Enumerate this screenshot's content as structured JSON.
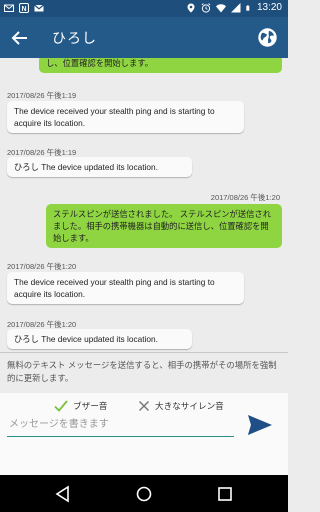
{
  "status_bar": {
    "left_icons": [
      "mail-icon",
      "notification-n-icon",
      "gmail-icon"
    ],
    "right_icons": [
      "location-icon",
      "alarm-icon",
      "wifi-icon",
      "signal-icon",
      "battery-icon"
    ],
    "time": "13:20"
  },
  "app_bar": {
    "title": "ひろし",
    "back_icon": "back-arrow-icon",
    "action_icon": "globe-icon",
    "color": "#245a89"
  },
  "messages": [
    {
      "direction": "out",
      "text": "し、位置確認を開始します。"
    },
    {
      "direction": "in",
      "timestamp": "2017/08/26 午後1:19",
      "text": "The device received your stealth ping and is starting to acquire its location."
    },
    {
      "direction": "in",
      "timestamp": "2017/08/26 午後1:19",
      "text": "ひろし The device updated its location."
    },
    {
      "direction": "out",
      "timestamp": "2017/08/26 午後1:20",
      "text": "ステルスピンが送信されました。 ステルスピンが送信されました。相手の携帯機器は自動的に送信し、位置確認を開始します。"
    },
    {
      "direction": "in",
      "timestamp": "2017/08/26 午後1:20",
      "text": "The device received your stealth ping and is starting to acquire its location."
    },
    {
      "direction": "in",
      "timestamp": "2017/08/26 午後1:20",
      "text": "ひろし The device updated its location."
    }
  ],
  "info_text": "無料のテキスト メッセージを送信すると、相手の携帯がその場所を強制的に更新します。",
  "options": {
    "buzzer": {
      "label": "ブザー音",
      "checked": true
    },
    "siren": {
      "label": "大きなサイレン音",
      "checked": false
    }
  },
  "composer": {
    "placeholder": "メッセージを書きます",
    "send_icon": "send-icon"
  },
  "nav_bar": {
    "icons": [
      "nav-back-icon",
      "nav-home-icon",
      "nav-recents-icon"
    ]
  },
  "colors": {
    "outgoing_bubble": "#8fd542",
    "incoming_bubble": "#fafafa",
    "accent": "#2f8f84",
    "send": "#1f4f86"
  }
}
